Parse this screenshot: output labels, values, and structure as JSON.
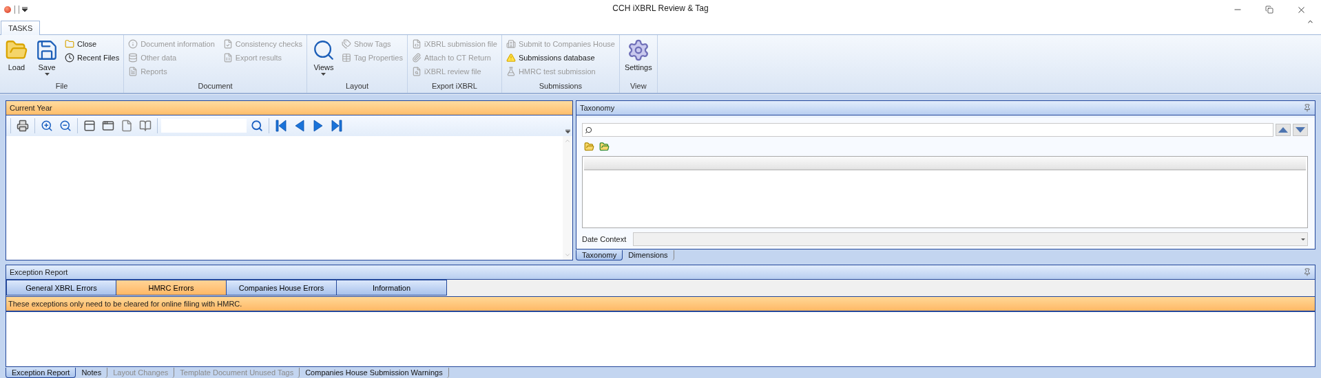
{
  "window": {
    "title": "CCH iXBRL Review & Tag"
  },
  "ribbon": {
    "tabs": [
      {
        "label": "TASKS",
        "selected": true
      }
    ],
    "groups": [
      {
        "label": "File",
        "items": [
          {
            "label": "Load",
            "kind": "large",
            "disabled": false
          },
          {
            "label": "Save",
            "kind": "large-menu",
            "disabled": false
          },
          {
            "label": "Close",
            "kind": "small",
            "disabled": false
          },
          {
            "label": "Recent Files",
            "kind": "small",
            "disabled": false
          }
        ]
      },
      {
        "label": "Document",
        "items": [
          {
            "label": "Document information",
            "kind": "small",
            "disabled": true
          },
          {
            "label": "Other data",
            "kind": "small",
            "disabled": true
          },
          {
            "label": "Reports",
            "kind": "small",
            "disabled": true
          },
          {
            "label": "Consistency checks",
            "kind": "small",
            "disabled": true
          },
          {
            "label": "Export results",
            "kind": "small",
            "disabled": true
          }
        ]
      },
      {
        "label": "Layout",
        "items": [
          {
            "label": "Views",
            "kind": "large-menu",
            "disabled": false
          },
          {
            "label": "Show Tags",
            "kind": "small",
            "disabled": true
          },
          {
            "label": "Tag Properties",
            "kind": "small",
            "disabled": true
          }
        ]
      },
      {
        "label": "Export iXBRL",
        "items": [
          {
            "label": "iXBRL submission file",
            "kind": "small",
            "disabled": true
          },
          {
            "label": "Attach to CT Return",
            "kind": "small",
            "disabled": true
          },
          {
            "label": "iXBRL review file",
            "kind": "small",
            "disabled": true
          }
        ]
      },
      {
        "label": "Submissions",
        "items": [
          {
            "label": "Submit to Companies House",
            "kind": "small",
            "disabled": true
          },
          {
            "label": "Submissions database",
            "kind": "small",
            "disabled": false
          },
          {
            "label": "HMRC test submission",
            "kind": "small",
            "disabled": true
          }
        ]
      },
      {
        "label": "View",
        "items": [
          {
            "label": "Settings",
            "kind": "large",
            "disabled": false
          }
        ]
      }
    ]
  },
  "current_year": {
    "title": "Current Year"
  },
  "taxonomy": {
    "title": "Taxonomy",
    "date_context_label": "Date Context",
    "tabs": [
      {
        "label": "Taxonomy",
        "selected": true
      },
      {
        "label": "Dimensions",
        "selected": false
      }
    ]
  },
  "exception_report": {
    "title": "Exception Report",
    "categories": [
      {
        "label": "General XBRL Errors",
        "selected": false
      },
      {
        "label": "HMRC Errors",
        "selected": true
      },
      {
        "label": "Companies House Errors",
        "selected": false
      },
      {
        "label": "Information",
        "selected": false
      }
    ],
    "message": "These exceptions only need to be cleared for online filing with HMRC.",
    "tabs": [
      {
        "label": "Exception Report",
        "selected": true,
        "disabled": false
      },
      {
        "label": "Notes",
        "selected": false,
        "disabled": false
      },
      {
        "label": "Layout Changes",
        "selected": false,
        "disabled": true
      },
      {
        "label": "Template Document Unused Tags",
        "selected": false,
        "disabled": true
      },
      {
        "label": "Companies House Submission Warnings",
        "selected": false,
        "disabled": false
      }
    ]
  }
}
